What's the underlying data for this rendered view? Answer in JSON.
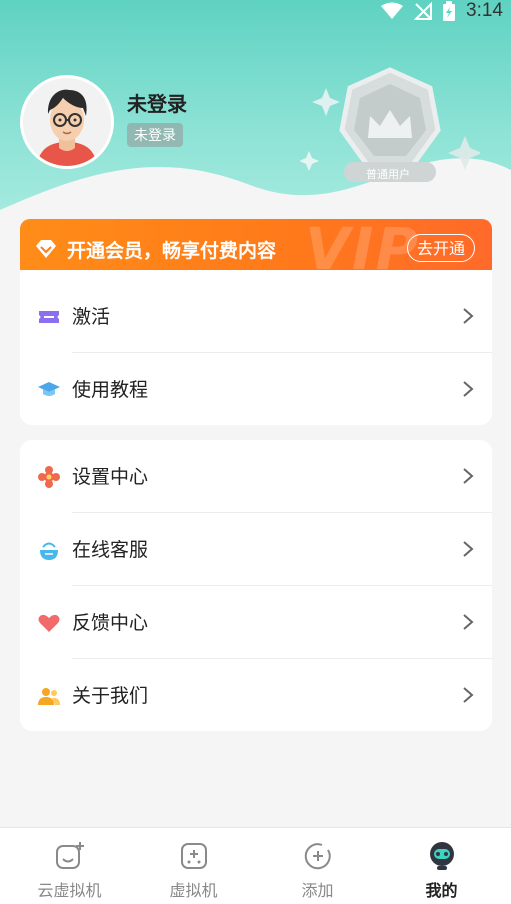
{
  "status_bar": {
    "time": "3:14"
  },
  "profile": {
    "username": "未登录",
    "login_badge": "未登录",
    "tier_label": "普通用户"
  },
  "vip_banner": {
    "text": "开通会员，畅享付费内容",
    "watermark": "VIP",
    "button_label": "去开通",
    "accent_color": "#ff7a1a"
  },
  "menu_group_1": [
    {
      "label": "激活",
      "icon": "ticket-icon"
    },
    {
      "label": "使用教程",
      "icon": "graduation-cap-icon"
    }
  ],
  "menu_group_2": [
    {
      "label": "设置中心",
      "icon": "gear-flower-icon"
    },
    {
      "label": "在线客服",
      "icon": "customer-service-icon"
    },
    {
      "label": "反馈中心",
      "icon": "heart-icon"
    },
    {
      "label": "关于我们",
      "icon": "users-icon"
    }
  ],
  "tabbar": [
    {
      "label": "云虚拟机",
      "icon": "cloud-vm-icon",
      "active": false
    },
    {
      "label": "虚拟机",
      "icon": "vm-icon",
      "active": false
    },
    {
      "label": "添加",
      "icon": "add-icon",
      "active": false
    },
    {
      "label": "我的",
      "icon": "robot-icon",
      "active": true
    }
  ]
}
